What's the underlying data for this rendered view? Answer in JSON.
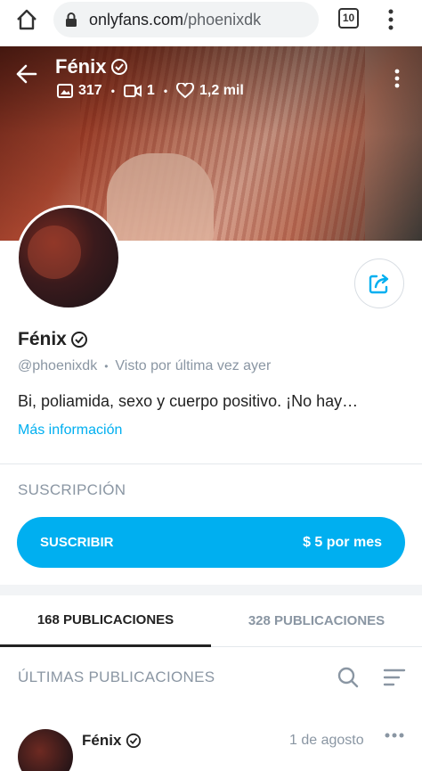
{
  "browser": {
    "url_host": "onlyfans.com",
    "url_path": "/phoenixdk",
    "tab_count": "10"
  },
  "cover": {
    "name": "Fénix",
    "photos": "317",
    "videos": "1",
    "likes": "1,2 mil"
  },
  "profile": {
    "name": "Fénix",
    "handle": "@phoenixdk",
    "last_seen": "Visto por última vez ayer",
    "bio": "Bi, poliamida, sexo y cuerpo positivo. ¡No hay…",
    "more_info": "Más información"
  },
  "subscription": {
    "title": "SUSCRIPCIÓN",
    "button_label": "SUSCRIBIR",
    "price": "$ 5 por mes"
  },
  "tabs": [
    {
      "label": "168 PUBLICACIONES"
    },
    {
      "label": "328 PUBLICACIONES"
    }
  ],
  "posts_section": {
    "title": "ÚLTIMAS PUBLICACIONES"
  },
  "post": {
    "author": "Fénix",
    "date": "1 de agosto"
  },
  "colors": {
    "accent": "#00aff0",
    "muted": "#8a96a3"
  }
}
